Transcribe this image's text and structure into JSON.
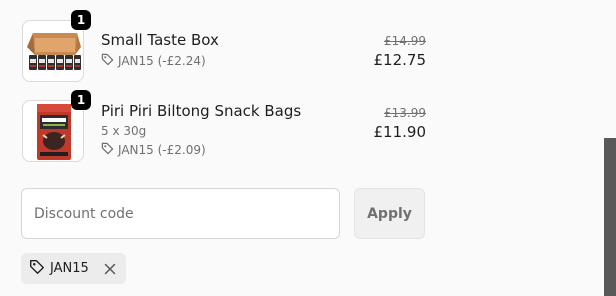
{
  "line_items": [
    {
      "quantity": "1",
      "title": "Small Taste Box",
      "variant": "",
      "discount": "JAN15 (-£2.24)",
      "original_price": "£14.99",
      "price": "£12.75"
    },
    {
      "quantity": "1",
      "title": "Piri Piri Biltong Snack Bags",
      "variant": "5 x 30g",
      "discount": "JAN15 (-£2.09)",
      "original_price": "£13.99",
      "price": "£11.90"
    }
  ],
  "discount_form": {
    "placeholder": "Discount code",
    "value": "",
    "apply_label": "Apply"
  },
  "applied_codes": [
    {
      "code": "JAN15"
    }
  ],
  "icons": {
    "discount": "tag-icon",
    "remove": "close-icon"
  },
  "colors": {
    "accent": "#000000",
    "muted_text": "#707070",
    "badge": "#000000"
  }
}
